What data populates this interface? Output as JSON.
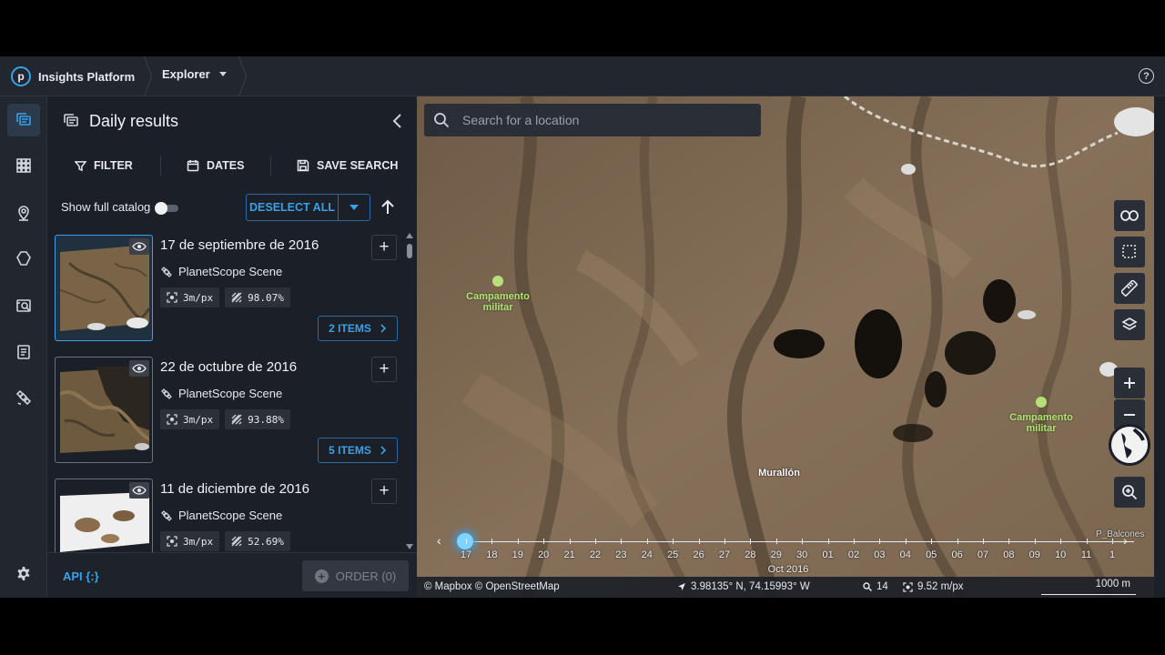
{
  "app": {
    "brand_logo_letter": "p",
    "brand_name": "Insights Platform",
    "section": "Explorer",
    "help_symbol": "?"
  },
  "rail": {
    "icons": [
      "results-icon",
      "grid-icon",
      "location-pin-icon",
      "polygon-icon",
      "image-search-icon",
      "document-icon",
      "satellite-icon"
    ],
    "active": "results-icon",
    "settings_icon": "gear-icon"
  },
  "panel": {
    "title": "Daily results",
    "toolbar": {
      "filter": "FILTER",
      "dates": "DATES",
      "save_search": "SAVE SEARCH"
    },
    "show_full_catalog": "Show full catalog",
    "show_full_catalog_on": false,
    "deselect_all": "DESELECT ALL",
    "results": [
      {
        "date": "17 de septiembre de 2016",
        "source": "PlanetScope Scene",
        "resolution": "3m/px",
        "coverage": "98.07%",
        "items": "2 ITEMS",
        "selected": true
      },
      {
        "date": "22 de octubre de 2016",
        "source": "PlanetScope Scene",
        "resolution": "3m/px",
        "coverage": "93.88%",
        "items": "5 ITEMS",
        "selected": false
      },
      {
        "date": "11 de diciembre de 2016",
        "source": "PlanetScope Scene",
        "resolution": "3m/px",
        "coverage": "52.69%",
        "items": "",
        "selected": false
      }
    ],
    "api_link": "API {:}",
    "order_button": "ORDER (0)"
  },
  "map": {
    "search_placeholder": "Search for a location",
    "labels": {
      "camp1": "Campamento militar",
      "camp2": "Campamento militar",
      "murallon": "Murallón",
      "corner": "P_Balcones"
    },
    "tool_icons": [
      "link-icon",
      "select-area-icon",
      "ruler-icon",
      "layers-icon",
      "zoom-in-icon",
      "zoom-out-icon",
      "globe-icon",
      "magnifier-icon"
    ],
    "timeline": {
      "days": [
        "17",
        "18",
        "19",
        "20",
        "21",
        "22",
        "23",
        "24",
        "25",
        "26",
        "27",
        "28",
        "29",
        "30",
        "01",
        "02",
        "03",
        "04",
        "05",
        "06",
        "07",
        "08",
        "09",
        "10",
        "11",
        "1"
      ],
      "month_label": "Oct 2016",
      "selected_day": "17"
    },
    "status": {
      "attribution": "© Mapbox © OpenStreetMap",
      "coordinates": "3.98135° N, 74.15993° W",
      "zoom": "14",
      "resolution": "9.52 m/px",
      "scale": "1000 m"
    }
  }
}
